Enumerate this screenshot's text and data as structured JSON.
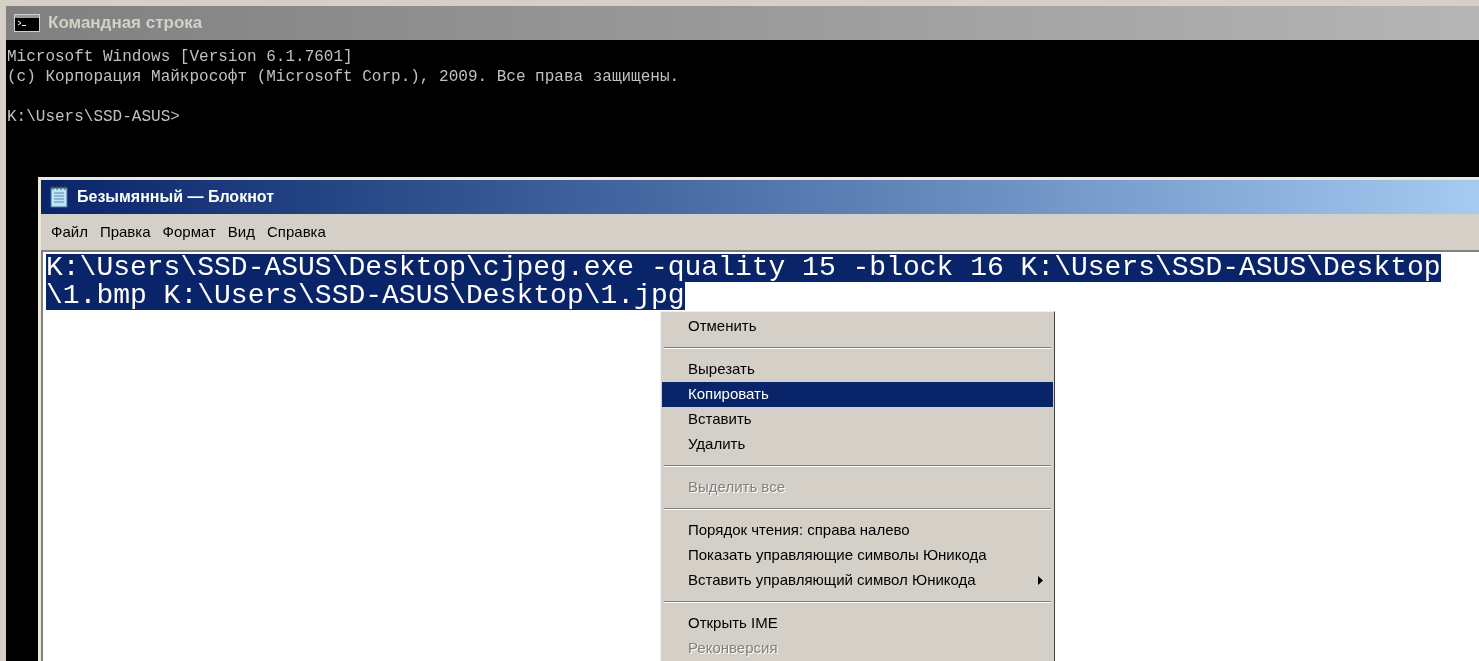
{
  "console_window": {
    "title": "Командная строка",
    "lines": [
      "Microsoft Windows [Version 6.1.7601]",
      "(c) Корпорация Майкрософт (Microsoft Corp.), 2009. Все права защищены."
    ],
    "prompt": "K:\\Users\\SSD-ASUS>"
  },
  "notepad_window": {
    "title": "Безымянный — Блокнот",
    "menu": [
      "Файл",
      "Правка",
      "Формат",
      "Вид",
      "Справка"
    ],
    "text_lines": [
      "K:\\Users\\SSD-ASUS\\Desktop\\cjpeg.exe -quality 15 -block 16 K:\\Users\\SSD-ASUS\\Desktop",
      "\\1.bmp K:\\Users\\SSD-ASUS\\Desktop\\1.jpg"
    ],
    "text_selected": true
  },
  "context_menu": {
    "items": [
      {
        "kind": "item",
        "label": "Отменить",
        "disabled": false,
        "selected": false,
        "submenu": false
      },
      {
        "kind": "separator"
      },
      {
        "kind": "item",
        "label": "Вырезать",
        "disabled": false,
        "selected": false,
        "submenu": false
      },
      {
        "kind": "item",
        "label": "Копировать",
        "disabled": false,
        "selected": true,
        "submenu": false
      },
      {
        "kind": "item",
        "label": "Вставить",
        "disabled": false,
        "selected": false,
        "submenu": false
      },
      {
        "kind": "item",
        "label": "Удалить",
        "disabled": false,
        "selected": false,
        "submenu": false
      },
      {
        "kind": "separator"
      },
      {
        "kind": "item",
        "label": "Выделить все",
        "disabled": true,
        "selected": false,
        "submenu": false
      },
      {
        "kind": "separator"
      },
      {
        "kind": "item",
        "label": "Порядок чтения: справа налево",
        "disabled": false,
        "selected": false,
        "submenu": false
      },
      {
        "kind": "item",
        "label": "Показать управляющие символы Юникода",
        "disabled": false,
        "selected": false,
        "submenu": false
      },
      {
        "kind": "item",
        "label": "Вставить управляющий символ Юникода",
        "disabled": false,
        "selected": false,
        "submenu": true
      },
      {
        "kind": "separator"
      },
      {
        "kind": "item",
        "label": "Открыть IME",
        "disabled": false,
        "selected": false,
        "submenu": false
      },
      {
        "kind": "item",
        "label": "Реконверсия",
        "disabled": true,
        "selected": false,
        "submenu": false
      }
    ]
  }
}
